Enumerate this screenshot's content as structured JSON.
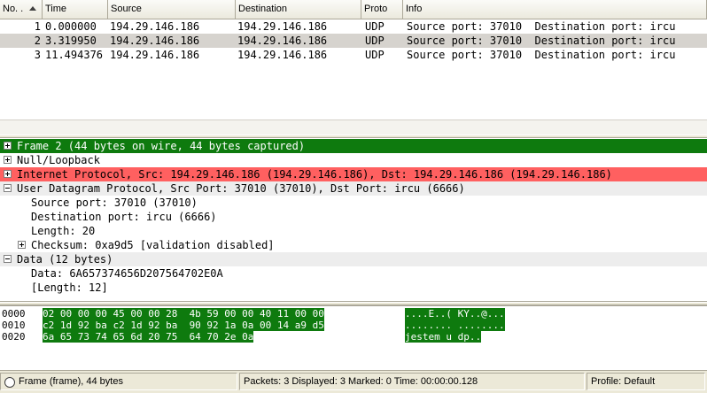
{
  "packet_list": {
    "columns": [
      "No. .",
      "Time",
      "Source",
      "Destination",
      "Proto",
      "Info"
    ],
    "rows": [
      {
        "no": "1",
        "time": "0.000000",
        "source": "194.29.146.186",
        "destination": "194.29.146.186",
        "protocol": "UDP",
        "info": "Source port: 37010  Destination port: ircu"
      },
      {
        "no": "2",
        "time": "3.319950",
        "source": "194.29.146.186",
        "destination": "194.29.146.186",
        "protocol": "UDP",
        "info": "Source port: 37010  Destination port: ircu"
      },
      {
        "no": "3",
        "time": "11.494376",
        "source": "194.29.146.186",
        "destination": "194.29.146.186",
        "protocol": "UDP",
        "info": "Source port: 37010  Destination port: ircu"
      }
    ],
    "selected_row": 2
  },
  "details": {
    "frame": "Frame 2 (44 bytes on wire, 44 bytes captured)",
    "null_loopback": "Null/Loopback",
    "ip": "Internet Protocol, Src: 194.29.146.186 (194.29.146.186), Dst: 194.29.146.186 (194.29.146.186)",
    "udp": "User Datagram Protocol, Src Port: 37010 (37010), Dst Port: ircu (6666)",
    "udp_src_port": "Source port: 37010 (37010)",
    "udp_dst_port": "Destination port: ircu (6666)",
    "udp_length": "Length: 20",
    "udp_checksum": "Checksum: 0xa9d5 [validation disabled]",
    "data": "Data (12 bytes)",
    "data_value": "Data: 6A657374656D207564702E0A",
    "data_length": "[Length: 12]"
  },
  "hex": {
    "rows": [
      {
        "offset": "0000",
        "bytes": "02 00 00 00 45 00 00 28  4b 59 00 00 40 11 00 00",
        "ascii": "....E..( KY..@..."
      },
      {
        "offset": "0010",
        "bytes": "c2 1d 92 ba c2 1d 92 ba  90 92 1a 0a 00 14 a9 d5",
        "ascii": "........ ........"
      },
      {
        "offset": "0020",
        "bytes": "6a 65 73 74 65 6d 20 75  64 70 2e 0a",
        "ascii": "jestem u dp.."
      }
    ],
    "highlight_color": "#0e7a0e"
  },
  "status": {
    "frame_info": "Frame (frame), 44 bytes",
    "packets_info": "Packets: 3 Displayed: 3 Marked: 0  Time: 00:00:00.128",
    "profile": "Profile: Default"
  },
  "colors": {
    "frame_row_bg": "#0e7a0e",
    "ip_row_bg": "#ff6060",
    "selected_packet_bg": "#d6d3ce"
  }
}
